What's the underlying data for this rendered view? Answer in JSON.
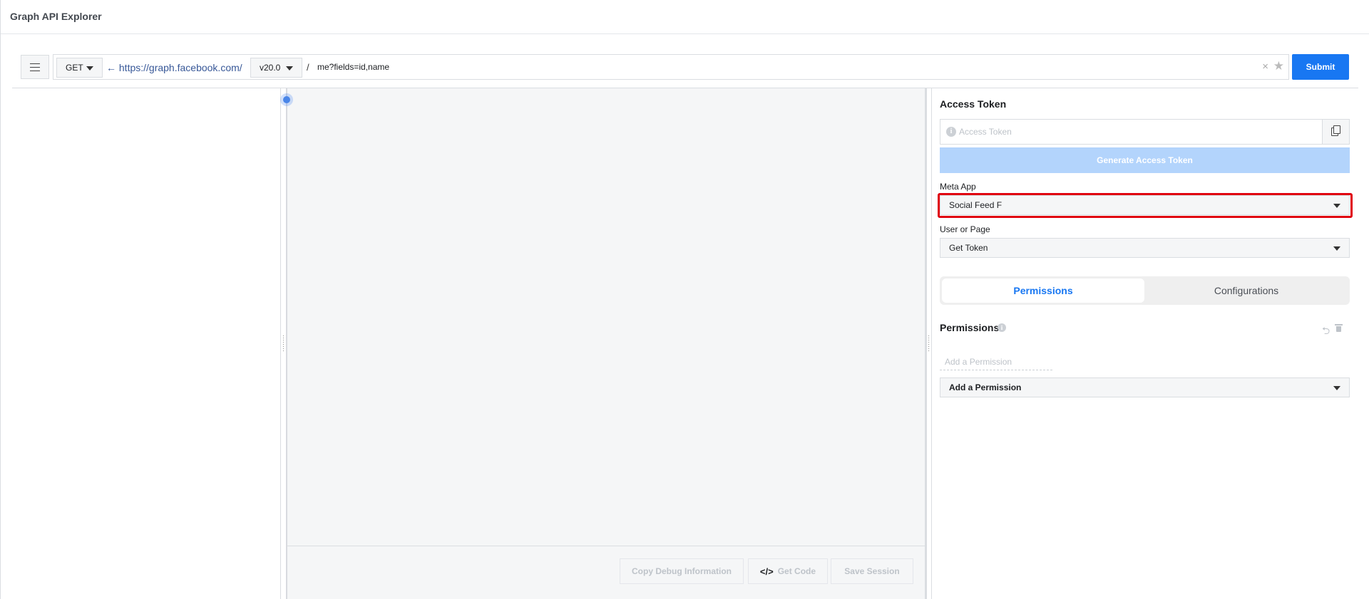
{
  "app": {
    "title": "Graph API Explorer"
  },
  "request_bar": {
    "menu_icon": "hamburger-menu-icon",
    "method": "GET",
    "base_url_arrow": "←",
    "base_url": "https://graph.facebook.com/",
    "version": "v20.0",
    "separator": "/",
    "path": "me?fields=id,name",
    "clear_icon": "×",
    "favorite_icon": "★",
    "submit_label": "Submit"
  },
  "center": {
    "footer_buttons": {
      "copy_debug": "Copy Debug Information",
      "get_code_icon": "</>",
      "get_code": "Get Code",
      "save_session": "Save Session"
    }
  },
  "right_panel": {
    "access_token": {
      "title": "Access Token",
      "info_icon": "i",
      "placeholder": "Access Token",
      "value": "",
      "generate_label": "Generate Access Token"
    },
    "meta_app": {
      "label": "Meta App",
      "selected": "Social Feed F"
    },
    "user_or_page": {
      "label": "User or Page",
      "selected": "Get Token"
    },
    "tabs": [
      {
        "label": "Permissions",
        "active": true
      },
      {
        "label": "Configurations",
        "active": false
      }
    ],
    "permissions": {
      "title": "Permissions",
      "info_icon": "i",
      "undo_icon": "⮌",
      "input_placeholder": "Add a Permission",
      "select_selected": "Add a Permission"
    }
  },
  "colors": {
    "primary": "#1877f2",
    "primary_disabled": "#b3d4fc",
    "highlight": "#e00010",
    "link": "#385898"
  }
}
